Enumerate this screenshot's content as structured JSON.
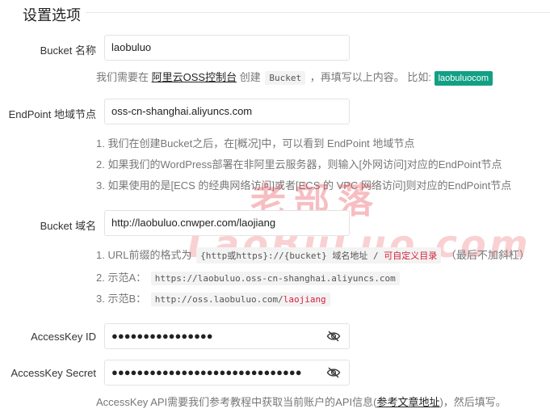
{
  "section_title": "设置选项",
  "bucket_name": {
    "label": "Bucket 名称",
    "value": "laobuluo",
    "help_prefix": "我们需要在",
    "help_link": "阿里云OSS控制台",
    "help_mid1": "创建",
    "help_code": "Bucket",
    "help_mid2": "，再填写以上内容。 比如:",
    "help_badge": "laobuluocom"
  },
  "endpoint": {
    "label": "EndPoint 地域节点",
    "value": "oss-cn-shanghai.aliyuncs.com",
    "notes": [
      "1. 我们在创建Bucket之后，在[概况]中，可以看到 EndPoint 地域节点",
      "2. 如果我们的WordPress部署在非阿里云服务器，则输入[外网访问]对应的EndPoint节点",
      "3. 如果使用的是[ECS 的经典网络访问]或者[ECS 的 VPC 网络访问]则对应的EndPoint节点"
    ]
  },
  "bucket_domain": {
    "label": "Bucket 域名",
    "value": "http://laobuluo.cnwper.com/laojiang",
    "note1_prefix": "1. URL前缀的格式为",
    "note1_code": "{http或https}://{bucket}",
    "note1_code_tail": "域名地址",
    "note1_code_sep": "/",
    "note1_code_red": "可自定义目录",
    "note1_suffix": "（最后不加斜杠）",
    "note2_prefix": "2. 示范A：",
    "note2_code": "https://laobuluo.oss-cn-shanghai.aliyuncs.com",
    "note3_prefix": "3. 示范B：",
    "note3_code": "http://oss.laobuluo.com/",
    "note3_code_red": "laojiang"
  },
  "access_key_id": {
    "label": "AccessKey ID",
    "value": "●●●●●●●●●●●●●●●●",
    "icon": "eye-slash-icon"
  },
  "access_key_secret": {
    "label": "AccessKey Secret",
    "value": "●●●●●●●●●●●●●●●●●●●●●●●●●●●●●●",
    "icon": "eye-slash-icon",
    "help_prefix": "AccessKey API需要我们参考教程中获取当前账户的API信息(",
    "help_link": "参考文章地址",
    "help_suffix": ")，然后填写。"
  },
  "watermark": {
    "line1": "老部落",
    "line2": "LaoBuLuo.com"
  }
}
